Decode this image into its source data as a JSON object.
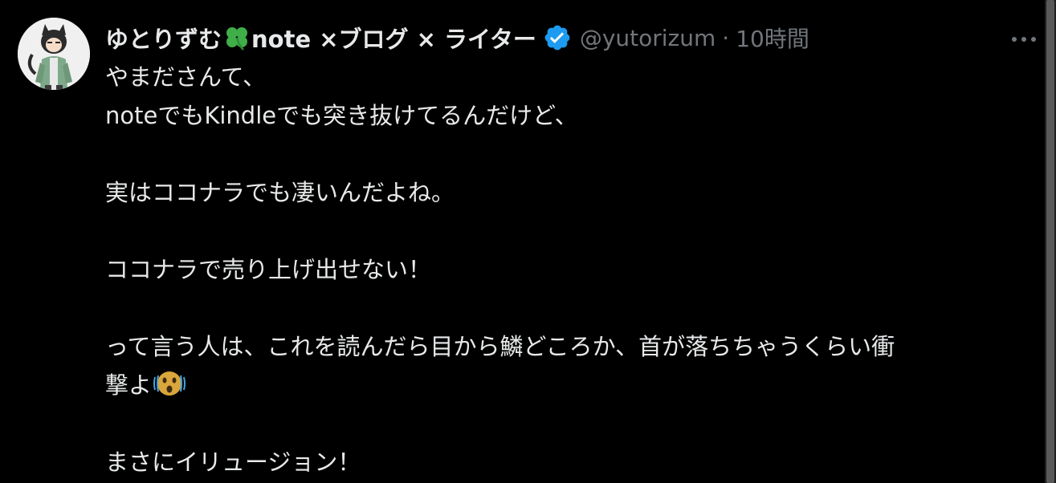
{
  "author": {
    "name_prefix": "ゆとりずむ",
    "name_suffix": "note ×ブログ × ライター",
    "handle": "@yutorizum",
    "separator": "·",
    "time": "10時間",
    "verified": true
  },
  "icons": {
    "name_emoji": "four-leaf-clover-icon",
    "badge": "verified-badge-icon",
    "more": "more-options-icon",
    "body_emoji": "shaking-face-icon"
  },
  "colors": {
    "background": "#000000",
    "text": "#e7e9ea",
    "secondary": "#71767b",
    "verified": "#1d9bf0"
  },
  "tweet": {
    "line1": "やまださんて、",
    "line2": "noteでもKindleでも突き抜けてるんだけど、",
    "line3": "実はココナラでも凄いんだよね。",
    "line4": "ココナラで売り上げ出せない！",
    "line5": "って言う人は、これを読んだら目から鱗どころか、首が落ちちゃうくらい衝",
    "line6": "撃よ",
    "line7": "まさにイリュージョン！"
  }
}
